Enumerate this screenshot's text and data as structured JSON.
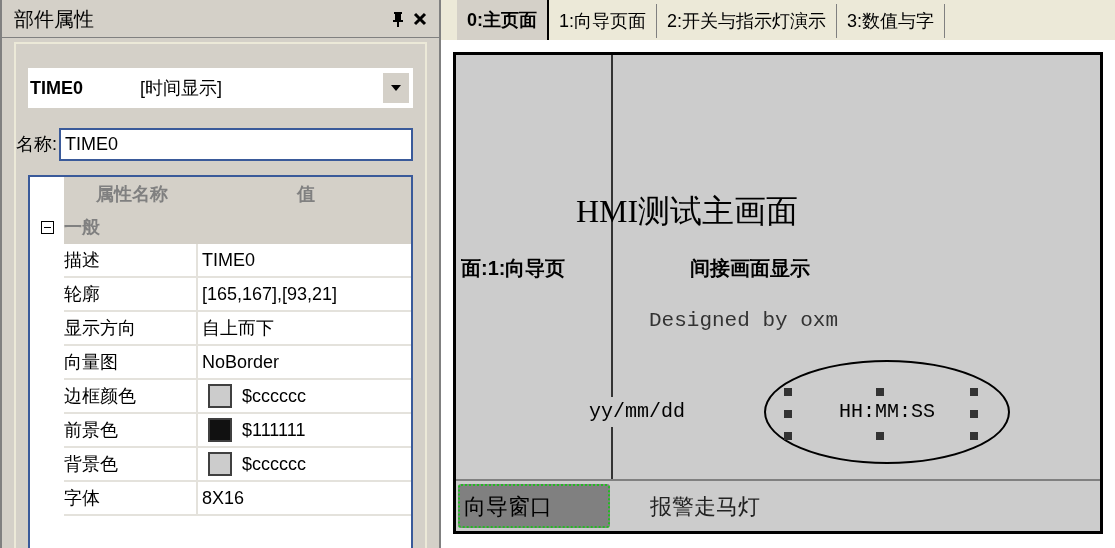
{
  "panel": {
    "title": "部件属性"
  },
  "component_select": {
    "name": "TIME0",
    "type": "[时间显示]"
  },
  "name_field": {
    "label": "名称:",
    "value": "TIME0"
  },
  "property_grid": {
    "columns": [
      "属性名称",
      "值"
    ],
    "groups": [
      {
        "label": "一般",
        "expanded": true,
        "rows": [
          {
            "kind": "text",
            "name": "描述",
            "value": "TIME0"
          },
          {
            "kind": "text",
            "name": "轮廓",
            "value": "[165,167],[93,21]"
          },
          {
            "kind": "text",
            "name": "显示方向",
            "value": "自上而下"
          },
          {
            "kind": "text",
            "name": "向量图",
            "value": "NoBorder"
          },
          {
            "kind": "color",
            "name": "边框颜色",
            "value": "$cccccc",
            "color": "#cccccc"
          },
          {
            "kind": "color",
            "name": "前景色",
            "value": "$111111",
            "color": "#111111"
          },
          {
            "kind": "color",
            "name": "背景色",
            "value": "$cccccc",
            "color": "#cccccc"
          },
          {
            "kind": "text",
            "name": "字体",
            "value": "8X16"
          }
        ]
      }
    ]
  },
  "tabs": [
    {
      "label": "0:主页面",
      "selected": true
    },
    {
      "label": "1:向导页面",
      "selected": false
    },
    {
      "label": "2:开关与指示灯演示",
      "selected": false
    },
    {
      "label": "3:数值与字",
      "selected": false
    }
  ],
  "canvas": {
    "title": "HMI测试主画面",
    "indirect_label": "面:1:向导页",
    "indirect_caption": "间接画面显示",
    "credit": "Designed by oxm",
    "date_format": "yy/mm/dd",
    "time_format": "HH:MM:SS",
    "time_selected": true,
    "bottom_bar": [
      {
        "label": "向导窗口",
        "selected": true
      },
      {
        "label": "报警走马灯",
        "selected": false
      }
    ]
  }
}
